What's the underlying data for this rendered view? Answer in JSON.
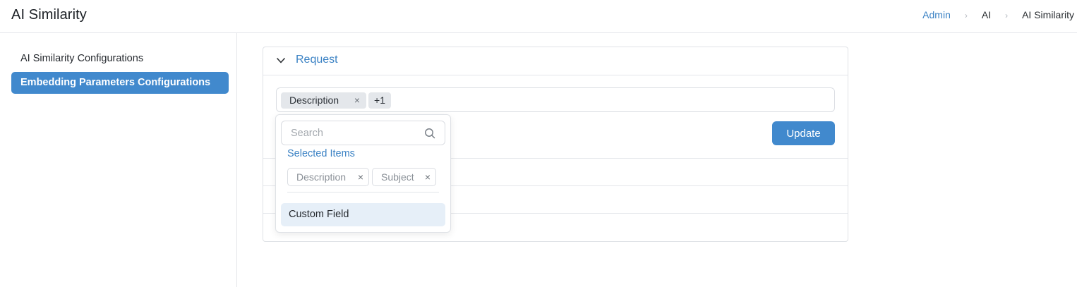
{
  "header": {
    "title": "AI Similarity",
    "breadcrumb": [
      "Admin",
      "AI",
      "AI Similarity"
    ],
    "separator": "›"
  },
  "sidebar": {
    "items": [
      {
        "label": "AI Similarity Configurations",
        "active": false
      },
      {
        "label": "Embedding Parameters Configurations",
        "active": true
      }
    ]
  },
  "panel": {
    "title": "Request",
    "multiselect": {
      "chips": [
        "Description"
      ],
      "more_label": "+1",
      "remove_glyph": "×"
    },
    "update_label": "Update"
  },
  "dropdown": {
    "search_placeholder": "Search",
    "selected_label": "Selected Items",
    "selected_items": [
      "Description",
      "Subject"
    ],
    "options": [
      "Custom Field"
    ]
  },
  "colors": {
    "accent": "#4189cd",
    "link": "#3b82c4",
    "option_hover": "#e6eff8"
  },
  "icons": {
    "collapse": "chevron-down-icon",
    "search": "search-icon",
    "remove": "close-icon",
    "breadcrumb_separator": "chevron-right-icon"
  }
}
